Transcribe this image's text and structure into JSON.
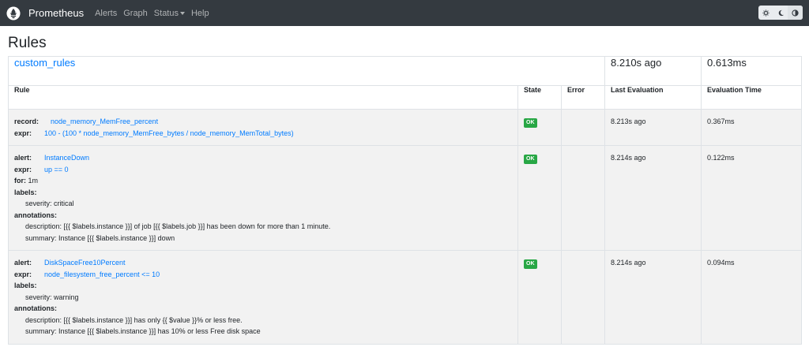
{
  "nav": {
    "brand": "Prometheus",
    "links": [
      "Alerts",
      "Graph",
      "Status",
      "Help"
    ],
    "theme_icons": [
      "sun-gear-icon",
      "moon-icon",
      "half-circle-icon"
    ]
  },
  "page": {
    "title": "Rules"
  },
  "group": {
    "name": "custom_rules",
    "last_evaluation": "8.210s ago",
    "evaluation_time": "0.613ms"
  },
  "columns": {
    "rule": "Rule",
    "state": "State",
    "error": "Error",
    "last_evaluation": "Last Evaluation",
    "evaluation_time": "Evaluation Time"
  },
  "rules": [
    {
      "record_label": "record:",
      "record": "node_memory_MemFree_percent",
      "expr_label": "expr:",
      "expr": "100 - (100 * node_memory_MemFree_bytes / node_memory_MemTotal_bytes)",
      "state": "OK",
      "error": "",
      "last_evaluation": "8.213s ago",
      "evaluation_time": "0.367ms"
    },
    {
      "alert_label": "alert:",
      "alert": "InstanceDown",
      "expr_label": "expr:",
      "expr": "up == 0",
      "for_label": "for:",
      "for": "1m",
      "labels_label": "labels:",
      "labels": [
        "severity: critical"
      ],
      "annotations_label": "annotations:",
      "annotations": [
        "description: [{{ $labels.instance }}] of job [{{ $labels.job }}] has been down for more than 1 minute.",
        "summary: Instance [{{ $labels.instance }}] down"
      ],
      "state": "OK",
      "error": "",
      "last_evaluation": "8.214s ago",
      "evaluation_time": "0.122ms"
    },
    {
      "alert_label": "alert:",
      "alert": "DiskSpaceFree10Percent",
      "expr_label": "expr:",
      "expr": "node_filesystem_free_percent <= 10",
      "labels_label": "labels:",
      "labels": [
        "severity: warning"
      ],
      "annotations_label": "annotations:",
      "annotations": [
        "description: [{{ $labels.instance }}] has only {{ $value }}% or less free.",
        "summary: Instance [{{ $labels.instance }}] has 10% or less Free disk space"
      ],
      "state": "OK",
      "error": "",
      "last_evaluation": "8.214s ago",
      "evaluation_time": "0.094ms"
    }
  ],
  "colors": {
    "navbar": "#343a40",
    "link": "#007bff",
    "ok_badge": "#28a745"
  }
}
